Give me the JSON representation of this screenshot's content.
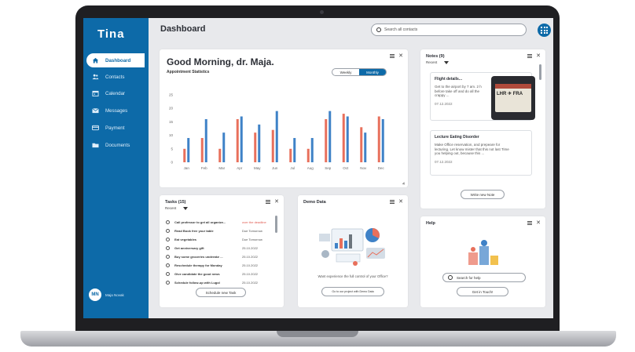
{
  "app": {
    "logo": "Tina"
  },
  "header": {
    "title": "Dashboard",
    "search_placeholder": "Search all contacts"
  },
  "sidebar": {
    "items": [
      {
        "label": "Dashboard",
        "icon": "home-icon",
        "active": true
      },
      {
        "label": "Contacts",
        "icon": "people-icon",
        "active": false
      },
      {
        "label": "Calendar",
        "icon": "calendar-icon",
        "active": false
      },
      {
        "label": "Messages",
        "icon": "mail-icon",
        "active": false
      },
      {
        "label": "Payment",
        "icon": "card-icon",
        "active": false
      },
      {
        "label": "Documents",
        "icon": "folder-icon",
        "active": false
      }
    ],
    "user": {
      "initials": "MN",
      "name": "Maja Novak"
    }
  },
  "greeting_card": {
    "greeting": "Good Morning, dr. Maja.",
    "subtitle": "Appointment Statistics",
    "toggle": {
      "weekly": "Weekly",
      "monthly": "Monthly",
      "selected": "Monthly"
    }
  },
  "chart_data": {
    "type": "bar",
    "categories": [
      "Jan",
      "Feb",
      "Mar",
      "Apr",
      "May",
      "Jun",
      "Jul",
      "Aug",
      "Sep",
      "Oct",
      "Nov",
      "Dec"
    ],
    "series": [
      {
        "color": "#e8705c",
        "values": [
          5,
          9,
          5,
          16,
          11,
          12,
          5,
          5,
          16,
          18,
          13,
          17
        ]
      },
      {
        "color": "#3f82c7",
        "values": [
          9,
          16,
          11,
          17,
          14,
          19,
          9,
          9,
          19,
          17,
          11,
          16
        ]
      }
    ],
    "yticks": [
      "0",
      "5",
      "10",
      "15",
      "20",
      "25"
    ],
    "ylim": [
      0,
      25
    ],
    "grid": false,
    "colors": {
      "series_a": "#e8705c",
      "series_b": "#3f82c7"
    }
  },
  "tasks_card": {
    "title": "Tasks (15)",
    "filter": "Recent",
    "items": [
      {
        "title": "Call professor to get all organize...",
        "due": "over the deadline",
        "overdue": true
      },
      {
        "title": "Read Book free your table",
        "due": "Due Tomorrow",
        "overdue": false
      },
      {
        "title": "Eat vegetables",
        "due": "Due Tomorrow",
        "overdue": false
      },
      {
        "title": "Get anniversary gift",
        "due": "25.10.2022",
        "overdue": false
      },
      {
        "title": "Buy some groceries underake ...",
        "due": "25.10.2022",
        "overdue": false
      },
      {
        "title": "Reschedule therapy for Monday",
        "due": "25.10.2022",
        "overdue": false
      },
      {
        "title": "Give candidate the good news",
        "due": "25.10.2022",
        "overdue": false
      },
      {
        "title": "Schedule follow-up with Lugol",
        "due": "25.10.2022",
        "overdue": false
      }
    ],
    "button": "Schedule new Task"
  },
  "demo_card": {
    "title": "Demo Data",
    "caption": "Want experience the full control of your Office?",
    "button": "Go to our project with Demo Data"
  },
  "notes_card": {
    "title": "Notes (9)",
    "filter": "Recent",
    "notes": [
      {
        "title": "Flight details...",
        "body": "Get to the airport by 7 am. 2 h before take off and do all the crappy ...",
        "date": "07.12.2022",
        "ticket": {
          "route": "LHR ✈ FRA"
        }
      },
      {
        "title": "Lecture Eating Disorder",
        "body": "Make Office reservation, and prepeare for lecturing. Let know mister that this not last Time you helping out, because this ...",
        "date": "07.12.2022"
      }
    ],
    "button": "Write new Note"
  },
  "help_card": {
    "title": "Help",
    "search_placeholder": "Search for help",
    "button": "Get in Touch!"
  }
}
